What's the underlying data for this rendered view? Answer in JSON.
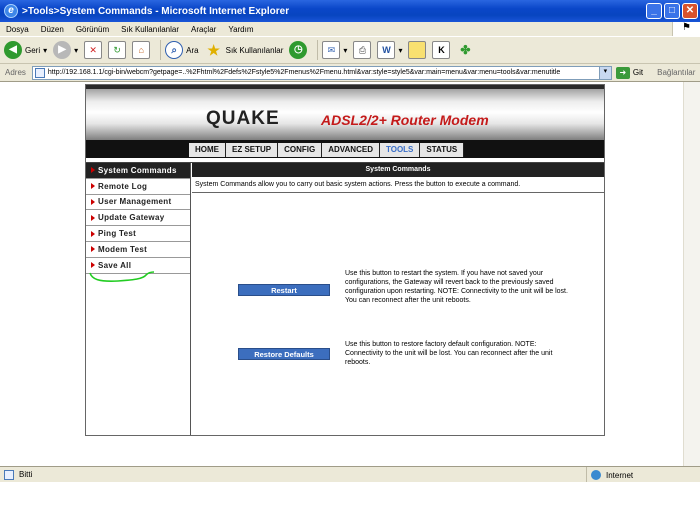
{
  "window": {
    "title": ">Tools>System Commands - Microsoft Internet Explorer"
  },
  "menubar": {
    "items": [
      "Dosya",
      "Düzen",
      "Görünüm",
      "Sık Kullanılanlar",
      "Araçlar",
      "Yardım"
    ]
  },
  "toolbar": {
    "back_label": "Geri",
    "search_label": "Ara",
    "favorites_label": "Sık Kullanılanlar"
  },
  "address": {
    "label": "Adres",
    "url": "http://192.168.1.1/cgi-bin/webcm?getpage=..%2Fhtml%2Fdefs%2Fstyle5%2Fmenus%2Fmenu.html&var:style=style5&var:main=menu&var:menu=tools&var:menutitle",
    "go_label": "Git",
    "links_label": "Bağlantılar"
  },
  "router": {
    "brand": "QUAKE",
    "tagline": "ADSL2/2+ Router Modem",
    "nav": [
      "HOME",
      "EZ SETUP",
      "CONFIG",
      "ADVANCED",
      "TOOLS",
      "STATUS"
    ],
    "active_nav": "TOOLS",
    "sidebar": [
      "System Commands",
      "Remote Log",
      "User Management",
      "Update Gateway",
      "Ping Test",
      "Modem Test",
      "Save All"
    ],
    "content": {
      "header": "System Commands",
      "intro": "System Commands allow you to carry out basic system actions. Press the button to execute a command.",
      "restart_button": "Restart",
      "restart_desc": "Use this button to restart the system. If you have not saved your configurations, the Gateway will revert back to the previously saved configuration upon restarting. NOTE: Connectivity to the unit will be lost. You can reconnect after the unit reboots.",
      "defaults_button": "Restore Defaults",
      "defaults_desc": "Use this button to restore factory default configuration. NOTE: Connectivity to the unit will be lost. You can reconnect after the unit reboots."
    }
  },
  "status": {
    "text": "Bitti",
    "zone": "Internet"
  },
  "colors": {
    "accent": "#3c6ebe",
    "tagline": "#c41a1a",
    "titlebar": "#0a46c8"
  }
}
